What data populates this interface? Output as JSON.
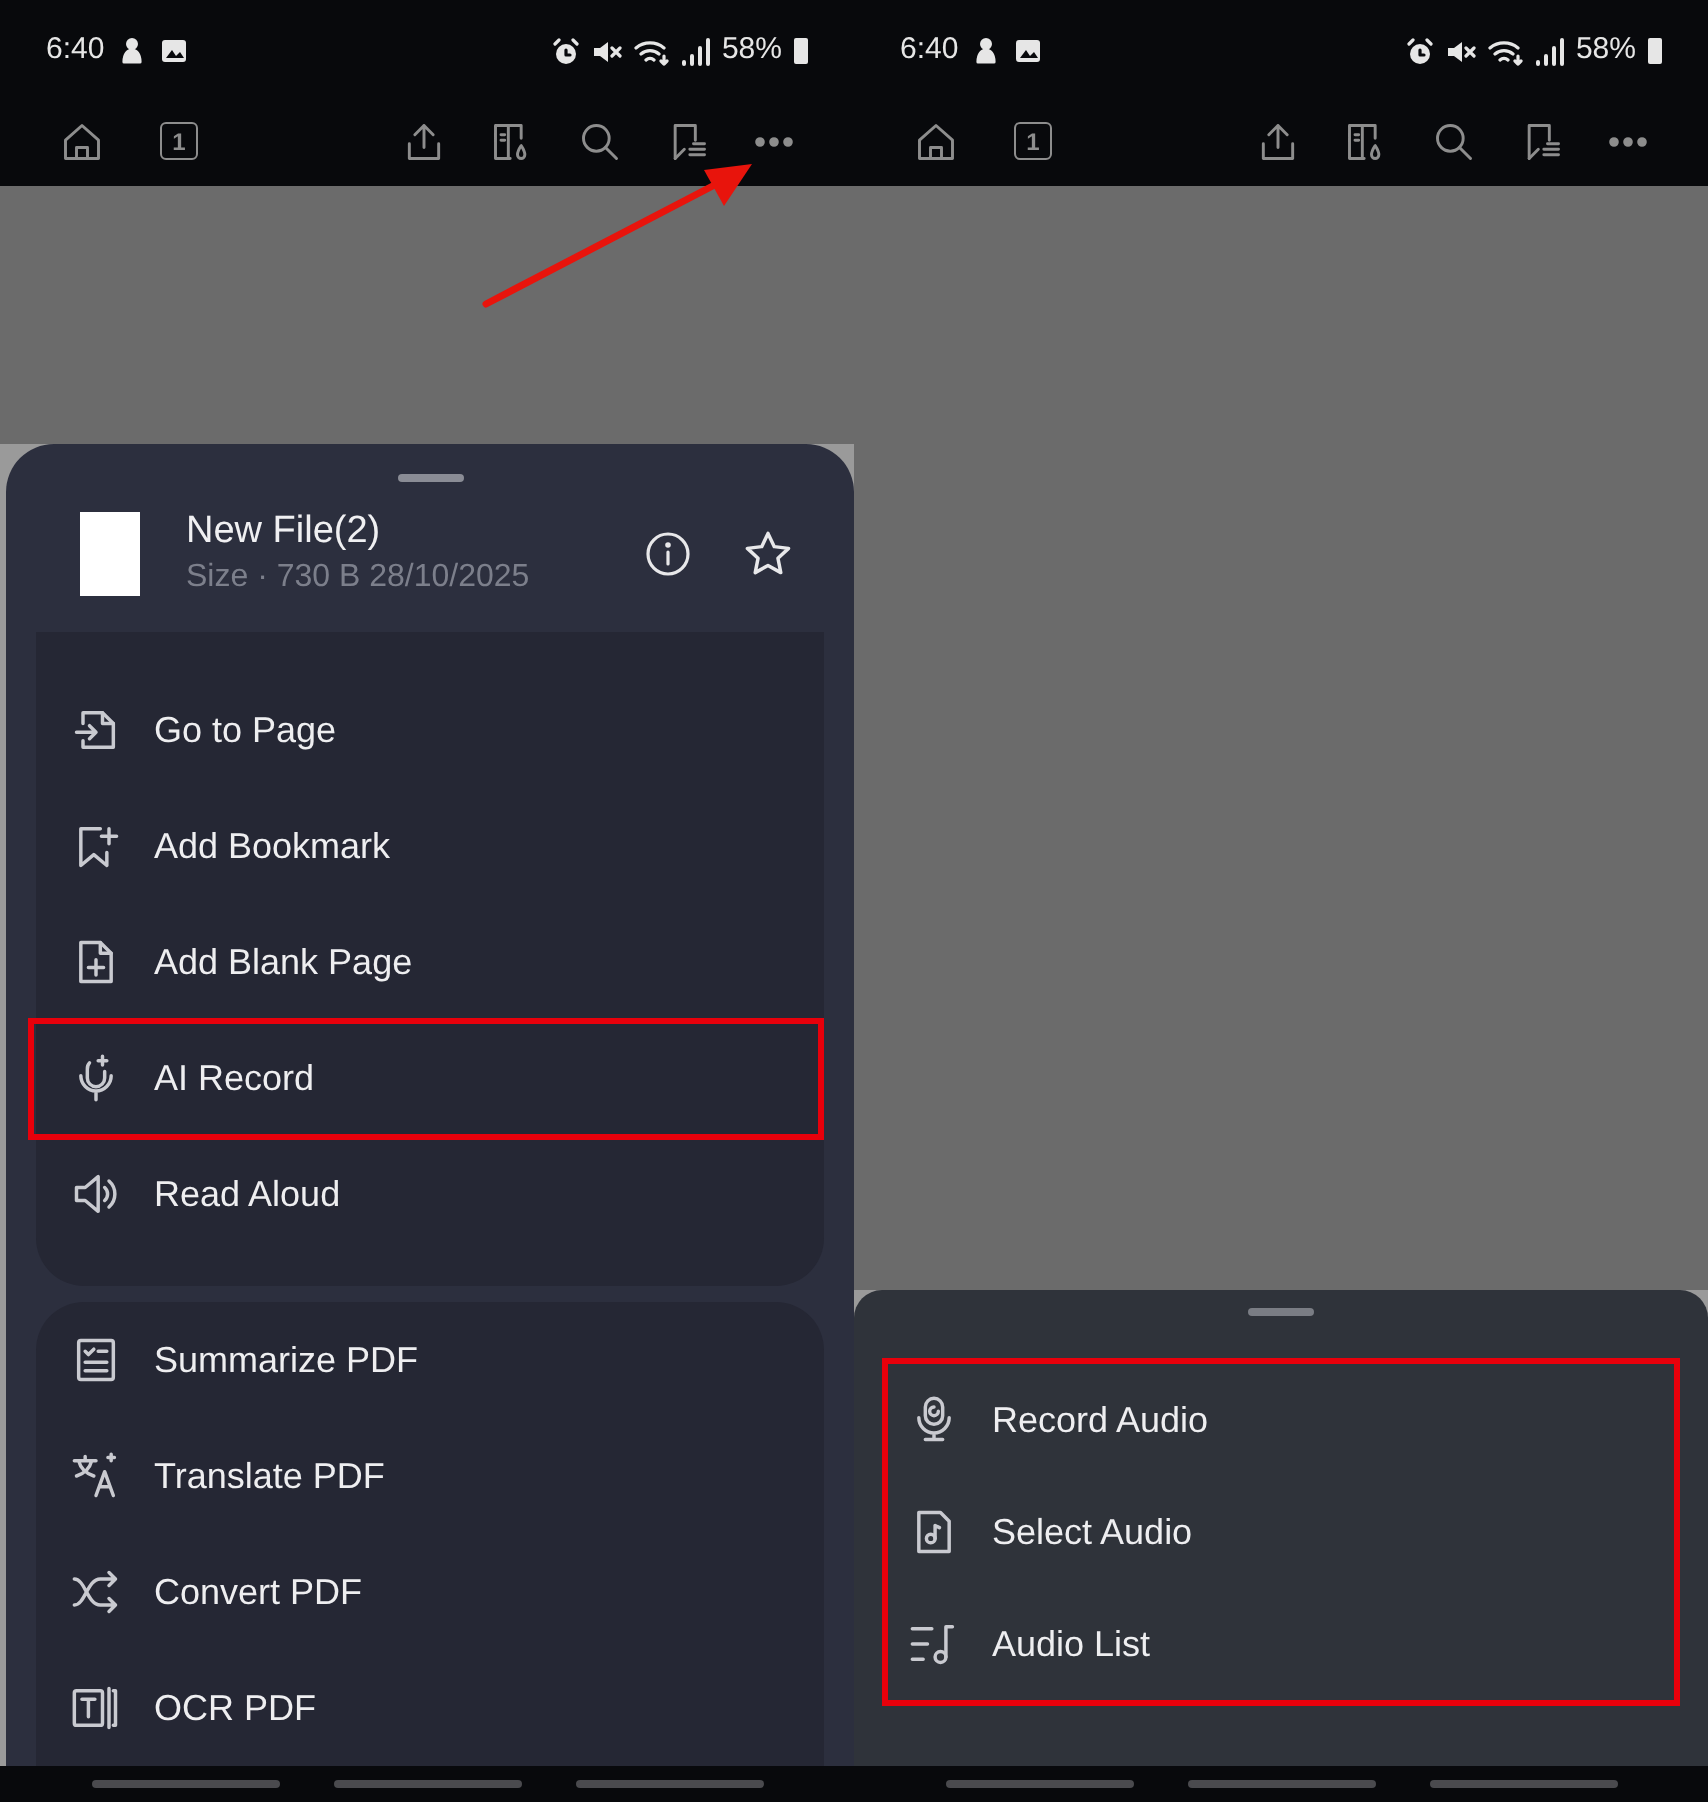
{
  "screens": [
    {
      "status_bar": {
        "time": "6:40",
        "battery": "58%"
      },
      "toolbar": {
        "page_number": "1"
      },
      "pointer_arrow": true,
      "sheet": {
        "kind": "file_menu",
        "file": {
          "name": "New File(2)",
          "meta": "Size · 730 B 28/10/2025"
        },
        "groups": [
          {
            "items": [
              {
                "label": "Go to Page",
                "kind": "goto",
                "highlighted": false
              },
              {
                "label": "Add Bookmark",
                "kind": "bookmark",
                "highlighted": false
              },
              {
                "label": "Add Blank Page",
                "kind": "blank",
                "highlighted": false
              },
              {
                "label": "AI Record",
                "kind": "airecord",
                "highlighted": true
              },
              {
                "label": "Read Aloud",
                "kind": "speaker",
                "highlighted": false
              }
            ]
          },
          {
            "items": [
              {
                "label": "Summarize PDF",
                "kind": "summary",
                "highlighted": false
              },
              {
                "label": "Translate PDF",
                "kind": "translate",
                "highlighted": false
              },
              {
                "label": "Convert PDF",
                "kind": "convert",
                "highlighted": false
              },
              {
                "label": "OCR PDF",
                "kind": "ocr",
                "highlighted": false
              }
            ]
          }
        ]
      }
    },
    {
      "status_bar": {
        "time": "6:40",
        "battery": "58%"
      },
      "toolbar": {
        "page_number": "1"
      },
      "sheet": {
        "kind": "audio_menu",
        "highlighted": true,
        "items": [
          {
            "label": "Record Audio",
            "kind": "mic"
          },
          {
            "label": "Select Audio",
            "kind": "audiofile"
          },
          {
            "label": "Audio List",
            "kind": "audiolist"
          }
        ]
      }
    }
  ]
}
